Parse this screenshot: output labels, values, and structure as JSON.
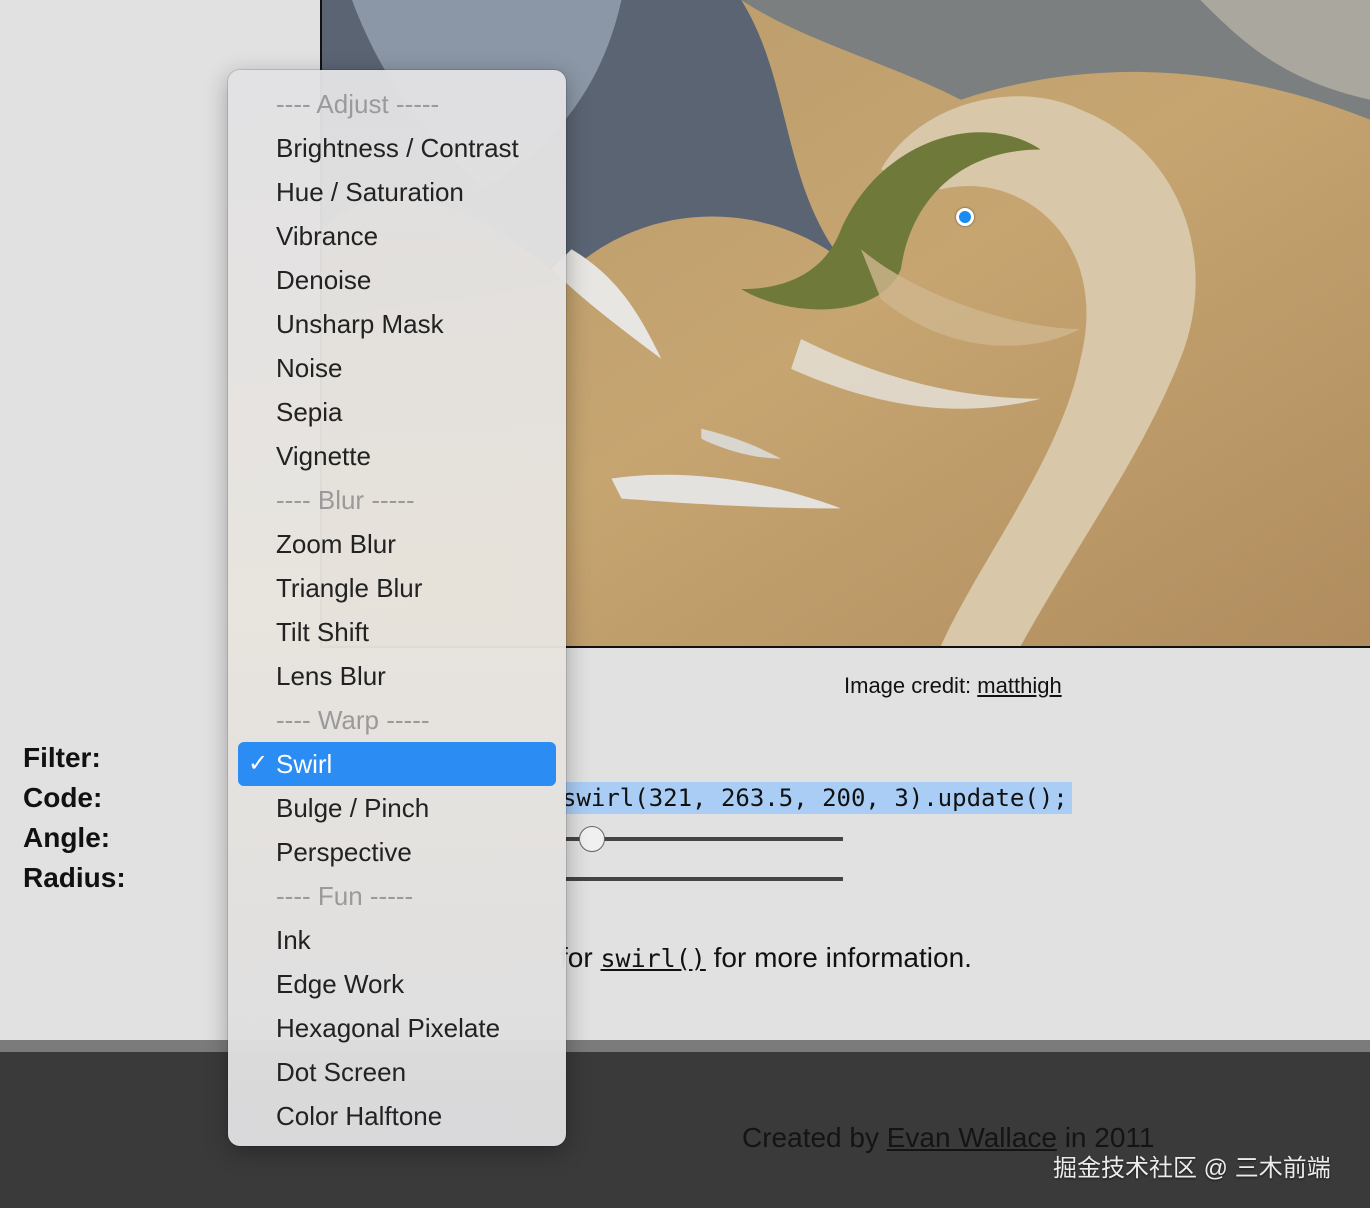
{
  "image_credit": {
    "label": "Image credit:",
    "link": "matthigh"
  },
  "form": {
    "filter_label": "Filter:",
    "code_label": "Code:",
    "angle_label": "Angle:",
    "radius_label": "Radius:",
    "code_text": "swirl(321, 263.5, 200, 3).update();",
    "angle_value_fraction": 0.05
  },
  "docs": {
    "prefix": "for",
    "fn": "swirl()",
    "suffix": "for more information."
  },
  "footer": {
    "created_prefix": "Created by",
    "author": "Evan Wallace",
    "suffix": "in 2011"
  },
  "watermark": "掘金技术社区 @ 三木前端",
  "menu": {
    "selected_check": "✓",
    "items": [
      {
        "label": "---- Adjust -----",
        "group": true
      },
      {
        "label": "Brightness / Contrast"
      },
      {
        "label": "Hue / Saturation"
      },
      {
        "label": "Vibrance"
      },
      {
        "label": "Denoise"
      },
      {
        "label": "Unsharp Mask"
      },
      {
        "label": "Noise"
      },
      {
        "label": "Sepia"
      },
      {
        "label": "Vignette"
      },
      {
        "label": "---- Blur -----",
        "group": true
      },
      {
        "label": "Zoom Blur"
      },
      {
        "label": "Triangle Blur"
      },
      {
        "label": "Tilt Shift"
      },
      {
        "label": "Lens Blur"
      },
      {
        "label": "---- Warp -----",
        "group": true
      },
      {
        "label": "Swirl",
        "selected": true
      },
      {
        "label": "Bulge / Pinch"
      },
      {
        "label": "Perspective"
      },
      {
        "label": "---- Fun -----",
        "group": true
      },
      {
        "label": "Ink"
      },
      {
        "label": "Edge Work"
      },
      {
        "label": "Hexagonal Pixelate"
      },
      {
        "label": "Dot Screen"
      },
      {
        "label": "Color Halftone"
      }
    ]
  },
  "colors": {
    "accent": "#2b8df3",
    "selection": "#a9cdf5",
    "footer_bg": "#3a3a3a"
  }
}
